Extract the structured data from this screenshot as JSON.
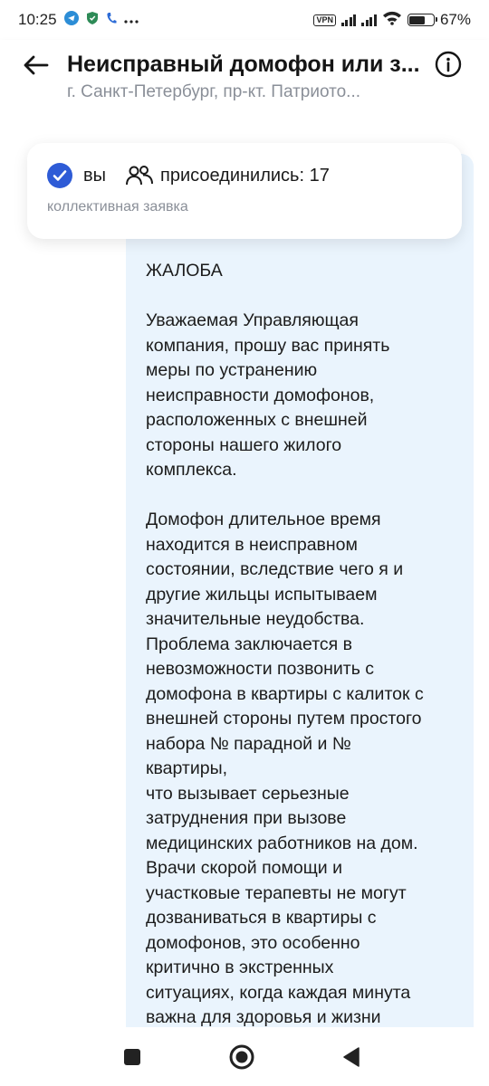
{
  "status_bar": {
    "time": "10:25",
    "vpn_label": "VPN",
    "battery_percent": "67",
    "battery_level": 0.67,
    "icons": [
      "telegram-icon",
      "shield-icon",
      "phone-icon",
      "more-dots-icon",
      "vpn-icon",
      "signal-icon",
      "signal-icon",
      "wifi-icon",
      "battery-icon"
    ]
  },
  "header": {
    "title": "Неисправный домофон или з...",
    "subtitle": "г. Санкт-Петербург, пр-кт. Патриото..."
  },
  "join_card": {
    "you_label": "вы",
    "joined_label": "присоединились: 17",
    "caption": "коллективная заявка",
    "accent_color": "#2e5bd6"
  },
  "message": {
    "heading": "ЖАЛОБА",
    "paragraph1": "Уважаемая Управляющая\nкомпания, прошу вас принять\nмеры по устранению\nнеисправности домофонов,\nрасположенных с внешней\nстороны нашего жилого\nкомплекса.",
    "paragraph2": "Домофон длительное время\nнаходится в неисправном\nсостоянии, вследствие чего я и\nдругие жильцы испытываем\nзначительные неудобства.\nПроблема заключается в\nневозможности позвонить с\nдомофона в квартиры с калиток с\nвнешней стороны путем простого\nнабора № парадной и №\nквартиры,\nчто вызывает серьезные\nзатруднения при вызове\nмедицинских работников на дом.\nВрачи скорой помощи и\nучастковые терапевты не могут\nдозваниваться в квартиры с\nдомофонов, это особенно\nкритично в экстренных\nситуациях, когда каждая минута\nважна для здоровья и жизни",
    "bubble_color": "#eaf4fd"
  },
  "nav_bar": {
    "icons": [
      "recents-square-icon",
      "home-circle-icon",
      "back-triangle-icon"
    ]
  }
}
